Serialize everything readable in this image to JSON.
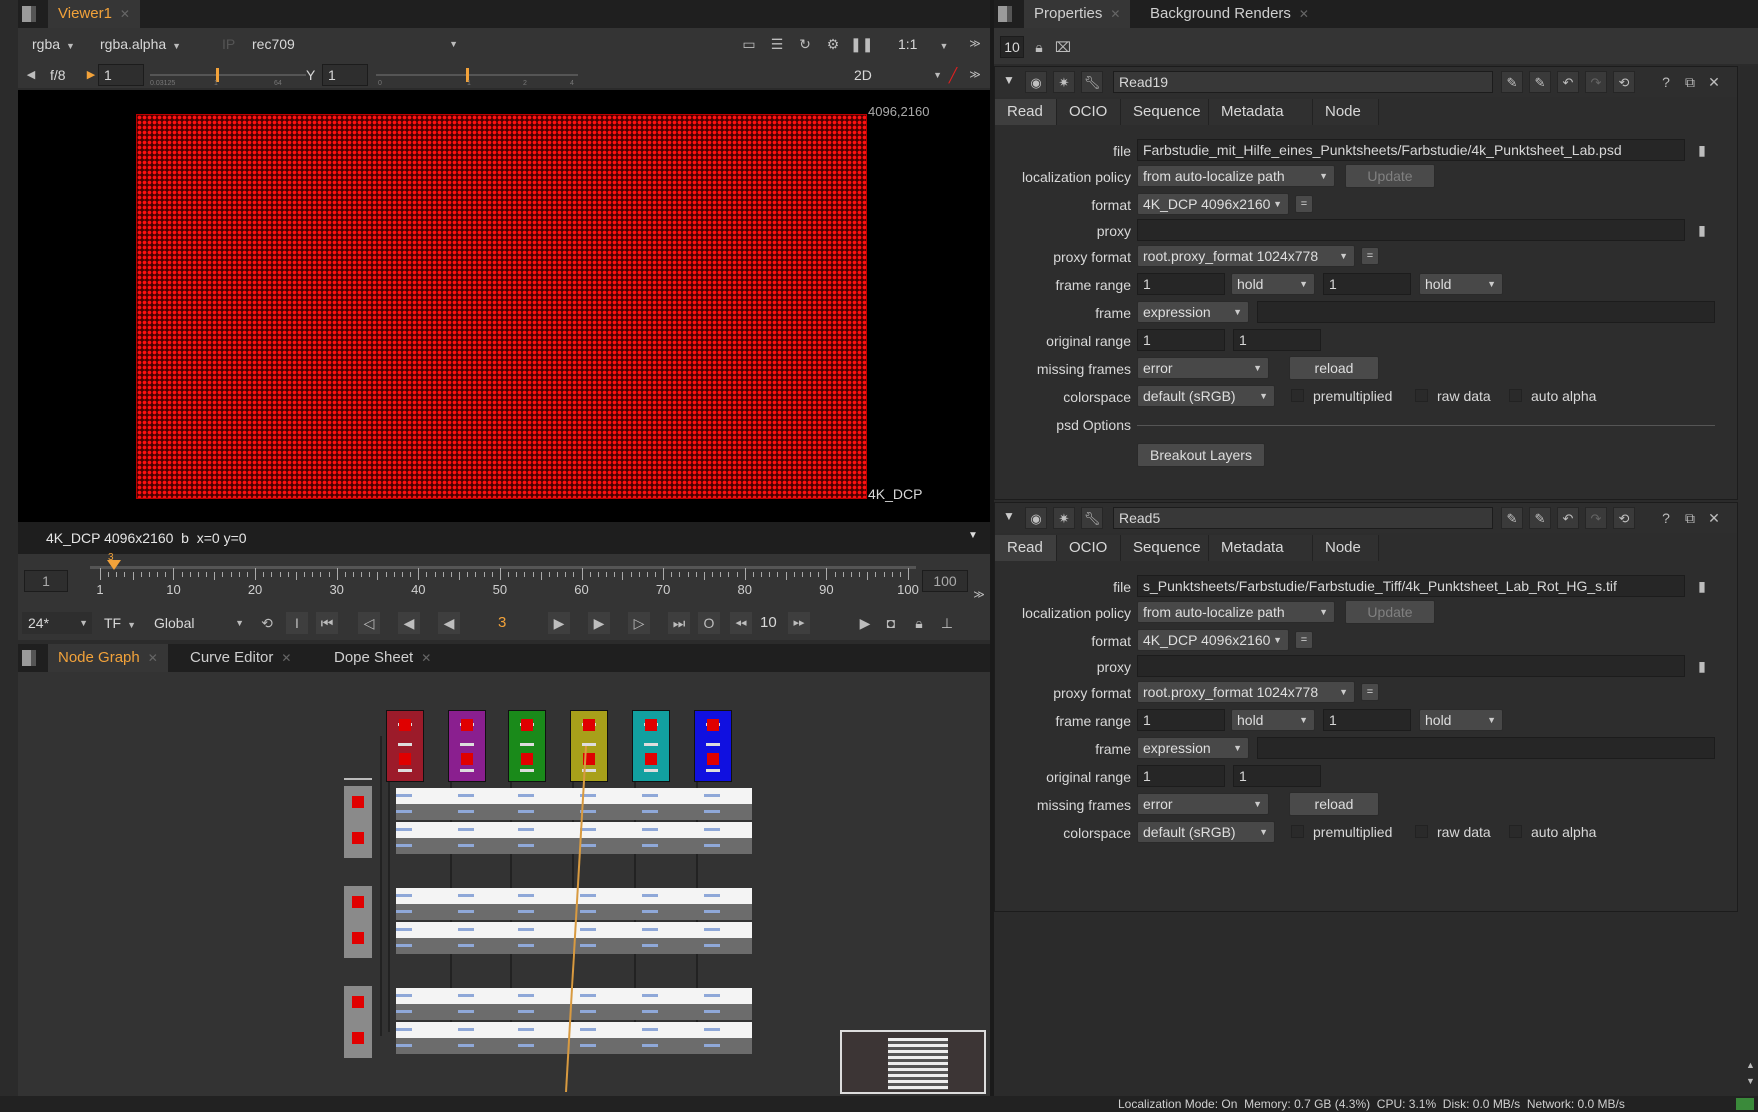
{
  "viewer": {
    "tab_title": "Viewer1",
    "channels": "rgba",
    "alpha_channel": "rgba.alpha",
    "ip": "IP",
    "lut": "rec709",
    "zoom": "1:1",
    "fstop": "f/8",
    "gain_value": "1",
    "gamma_label": "Y",
    "gamma_value": "1",
    "gain_scale": [
      "0.03125",
      "1",
      "64"
    ],
    "gamma_scale": [
      "0",
      "1",
      "2",
      "4"
    ],
    "view_mode": "2D",
    "corner_label": "4096,2160",
    "format_label": "4K_DCP",
    "info_bar": "4K_DCP 4096x2160  b  x=0 y=0",
    "image_color": "#cc0000"
  },
  "timeline": {
    "start": "1",
    "end": "100",
    "current_frame": "3",
    "ticks": [
      1,
      10,
      20,
      30,
      40,
      50,
      60,
      70,
      80,
      90,
      100
    ],
    "fps": "24*",
    "tf": "TF",
    "scope": "Global",
    "in_label": "I",
    "out_label": "O",
    "step": "10"
  },
  "bottom_tabs": [
    {
      "label": "Node Graph"
    },
    {
      "label": "Curve Editor"
    },
    {
      "label": "Dope Sheet"
    }
  ],
  "node_graph": {
    "top_nodes": [
      {
        "color": "#9c1b2a"
      },
      {
        "color": "#8a1f8f"
      },
      {
        "color": "#1a8a1a"
      },
      {
        "color": "#a8a01a"
      },
      {
        "color": "#12a0a0"
      },
      {
        "color": "#1010e0"
      }
    ]
  },
  "right_tabs": [
    {
      "label": "Properties"
    },
    {
      "label": "Background Renders"
    }
  ],
  "properties_toolbar": {
    "max_panels": "10"
  },
  "read_nodes": [
    {
      "name": "Read19",
      "tabs": [
        "Read",
        "OCIO",
        "Sequence",
        "Metadata",
        "Node"
      ],
      "file_label": "file",
      "file": "Farbstudie_mit_Hilfe_eines_Punktsheets/Farbstudie/4k_Punktsheet_Lab.psd",
      "localization_policy_label": "localization policy",
      "localization_policy": "from auto-localize path",
      "update_label": "Update",
      "format_label": "format",
      "format": "4K_DCP 4096x2160",
      "proxy_label": "proxy",
      "proxy": "",
      "proxy_format_label": "proxy format",
      "proxy_format": "root.proxy_format 1024x778",
      "frame_range_label": "frame range",
      "frame_range_start": "1",
      "frame_range_before": "hold",
      "frame_range_end": "1",
      "frame_range_after": "hold",
      "frame_label": "frame",
      "frame_mode": "expression",
      "original_range_label": "original range",
      "original_range_start": "1",
      "original_range_end": "1",
      "missing_frames_label": "missing frames",
      "missing_frames": "error",
      "reload_label": "reload",
      "colorspace_label": "colorspace",
      "colorspace": "default (sRGB)",
      "premultiplied_label": "premultiplied",
      "raw_data_label": "raw data",
      "auto_alpha_label": "auto alpha",
      "psd_options_label": "psd Options",
      "breakout_label": "Breakout Layers"
    },
    {
      "name": "Read5",
      "tabs": [
        "Read",
        "OCIO",
        "Sequence",
        "Metadata",
        "Node"
      ],
      "file_label": "file",
      "file": "s_Punktsheets/Farbstudie/Farbstudie_Tiff/4k_Punktsheet_Lab_Rot_HG_s.tif",
      "localization_policy_label": "localization policy",
      "localization_policy": "from auto-localize path",
      "update_label": "Update",
      "format_label": "format",
      "format": "4K_DCP 4096x2160",
      "proxy_label": "proxy",
      "proxy": "",
      "proxy_format_label": "proxy format",
      "proxy_format": "root.proxy_format 1024x778",
      "frame_range_label": "frame range",
      "frame_range_start": "1",
      "frame_range_before": "hold",
      "frame_range_end": "1",
      "frame_range_after": "hold",
      "frame_label": "frame",
      "frame_mode": "expression",
      "original_range_label": "original range",
      "original_range_start": "1",
      "original_range_end": "1",
      "missing_frames_label": "missing frames",
      "missing_frames": "error",
      "reload_label": "reload",
      "colorspace_label": "colorspace",
      "colorspace": "default (sRGB)",
      "premultiplied_label": "premultiplied",
      "raw_data_label": "raw data",
      "auto_alpha_label": "auto alpha"
    }
  ],
  "status_bar": "Localization Mode: On  Memory: 0.7 GB (4.3%)  CPU: 3.1%  Disk: 0.0 MB/s  Network: 0.0 MB/s"
}
